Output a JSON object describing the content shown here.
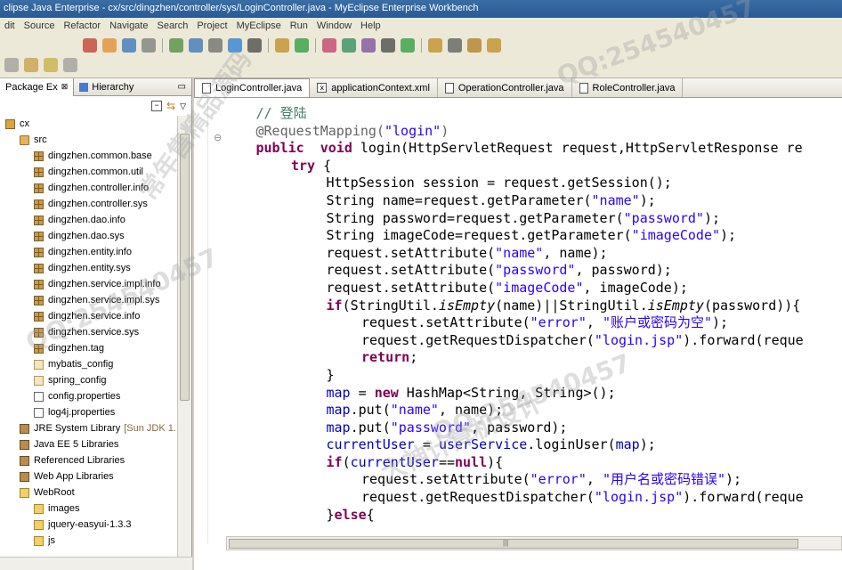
{
  "window": {
    "title": "clipse Java Enterprise - cx/src/dingzhen/controller/sys/LoginController.java - MyEclipse Enterprise Workbench"
  },
  "menu": [
    "dit",
    "Source",
    "Refactor",
    "Navigate",
    "Search",
    "Project",
    "MyEclipse",
    "Run",
    "Window",
    "Help"
  ],
  "left_tabs": {
    "package_explorer": "Package Ex",
    "hierarchy": "Hierarchy"
  },
  "tree": [
    {
      "label": "cx",
      "icon": "project-icon",
      "indent": 0
    },
    {
      "label": "src",
      "icon": "source-folder-icon",
      "indent": 1
    },
    {
      "label": "dingzhen.common.base",
      "icon": "package-icon",
      "indent": 2
    },
    {
      "label": "dingzhen.common.util",
      "icon": "package-icon",
      "indent": 2
    },
    {
      "label": "dingzhen.controller.info",
      "icon": "package-icon",
      "indent": 2
    },
    {
      "label": "dingzhen.controller.sys",
      "icon": "package-icon",
      "indent": 2
    },
    {
      "label": "dingzhen.dao.info",
      "icon": "package-icon",
      "indent": 2
    },
    {
      "label": "dingzhen.dao.sys",
      "icon": "package-icon",
      "indent": 2
    },
    {
      "label": "dingzhen.entity.info",
      "icon": "package-icon",
      "indent": 2
    },
    {
      "label": "dingzhen.entity.sys",
      "icon": "package-icon",
      "indent": 2
    },
    {
      "label": "dingzhen.service.impl.info",
      "icon": "package-icon",
      "indent": 2
    },
    {
      "label": "dingzhen.service.impl.sys",
      "icon": "package-icon",
      "indent": 2
    },
    {
      "label": "dingzhen.service.info",
      "icon": "package-icon",
      "indent": 2
    },
    {
      "label": "dingzhen.service.sys",
      "icon": "package-icon",
      "indent": 2
    },
    {
      "label": "dingzhen.tag",
      "icon": "package-icon",
      "indent": 2
    },
    {
      "label": "mybatis_config",
      "icon": "empty-package-icon",
      "indent": 2
    },
    {
      "label": "spring_config",
      "icon": "empty-package-icon",
      "indent": 2
    },
    {
      "label": "config.properties",
      "icon": "file-icon",
      "indent": 2
    },
    {
      "label": "log4j.properties",
      "icon": "file-icon",
      "indent": 2
    },
    {
      "label": "JRE System Library",
      "suffix": "[Sun JDK 1.",
      "icon": "library-icon",
      "indent": 1
    },
    {
      "label": "Java EE 5 Libraries",
      "icon": "library-icon",
      "indent": 1
    },
    {
      "label": "Referenced Libraries",
      "icon": "library-icon",
      "indent": 1
    },
    {
      "label": "Web App Libraries",
      "icon": "library-icon",
      "indent": 1
    },
    {
      "label": "WebRoot",
      "icon": "folder-icon",
      "indent": 1
    },
    {
      "label": "images",
      "icon": "folder-icon",
      "indent": 2
    },
    {
      "label": "jquery-easyui-1.3.3",
      "icon": "folder-icon",
      "indent": 2
    },
    {
      "label": "js",
      "icon": "folder-icon",
      "indent": 2
    }
  ],
  "editor_tabs": [
    {
      "label": "LoginController.java",
      "active": true,
      "icon": "java-file-icon"
    },
    {
      "label": "applicationContext.xml",
      "active": false,
      "icon": "xml-file-icon"
    },
    {
      "label": "OperationController.java",
      "active": false,
      "icon": "java-file-icon"
    },
    {
      "label": "RoleController.java",
      "active": false,
      "icon": "java-file-icon"
    }
  ],
  "code_lines": [
    [
      [
        "cmt",
        "// 登陆"
      ]
    ],
    [
      [
        "ann",
        "@RequestMapping("
      ],
      [
        "str",
        "\"login\""
      ],
      [
        "ann",
        ")"
      ]
    ],
    [
      [
        "kw",
        "public"
      ],
      [
        "",
        "  "
      ],
      [
        "kw",
        "void"
      ],
      [
        "",
        " login(HttpServletRequest request,HttpServletResponse re"
      ]
    ],
    [
      [
        "kw",
        "try"
      ],
      [
        "",
        " {"
      ]
    ],
    [
      [
        "",
        "HttpSession session = request.getSession();"
      ]
    ],
    [
      [
        "",
        "String name=request.getParameter("
      ],
      [
        "str",
        "\"name\""
      ],
      [
        "",
        ");"
      ]
    ],
    [
      [
        "",
        "String password=request.getParameter("
      ],
      [
        "str",
        "\"password\""
      ],
      [
        "",
        ");"
      ]
    ],
    [
      [
        "",
        "String imageCode=request.getParameter("
      ],
      [
        "str",
        "\"imageCode\""
      ],
      [
        "",
        ");"
      ]
    ],
    [
      [
        "",
        "request.setAttribute("
      ],
      [
        "str",
        "\"name\""
      ],
      [
        "",
        ", name);"
      ]
    ],
    [
      [
        "",
        "request.setAttribute("
      ],
      [
        "str",
        "\"password\""
      ],
      [
        "",
        ", password);"
      ]
    ],
    [
      [
        "",
        "request.setAttribute("
      ],
      [
        "str",
        "\"imageCode\""
      ],
      [
        "",
        ", imageCode);"
      ]
    ],
    [
      [
        "kw",
        "if"
      ],
      [
        "",
        "(StringUtil."
      ],
      [
        "itl",
        "isEmpty"
      ],
      [
        "",
        "(name)||StringUtil."
      ],
      [
        "itl",
        "isEmpty"
      ],
      [
        "",
        "(password)){"
      ]
    ],
    [
      [
        "",
        "request.setAttribute("
      ],
      [
        "str",
        "\"error\""
      ],
      [
        "",
        ", "
      ],
      [
        "str",
        "\"账户或密码为空\""
      ],
      [
        "",
        ");"
      ]
    ],
    [
      [
        "",
        "request.getRequestDispatcher("
      ],
      [
        "str",
        "\"login.jsp\""
      ],
      [
        "",
        ").forward(reque"
      ]
    ],
    [
      [
        "kw",
        "return"
      ],
      [
        "",
        ";"
      ]
    ],
    [
      [
        "",
        "}"
      ]
    ],
    [
      [
        "fld",
        "map"
      ],
      [
        "",
        " = "
      ],
      [
        "kw",
        "new"
      ],
      [
        "",
        " HashMap<String, String>();"
      ]
    ],
    [
      [
        "fld",
        "map"
      ],
      [
        "",
        ".put("
      ],
      [
        "str",
        "\"name\""
      ],
      [
        "",
        ", name);"
      ]
    ],
    [
      [
        "fld",
        "map"
      ],
      [
        "",
        ".put("
      ],
      [
        "str",
        "\"password\""
      ],
      [
        "",
        ", password);"
      ]
    ],
    [
      [
        "fld",
        "currentUser"
      ],
      [
        "",
        " = "
      ],
      [
        "fld",
        "userService"
      ],
      [
        "",
        ".loginUser("
      ],
      [
        "fld",
        "map"
      ],
      [
        "",
        ");"
      ]
    ],
    [
      [
        "kw",
        "if"
      ],
      [
        "",
        "("
      ],
      [
        "fld",
        "currentUser"
      ],
      [
        "",
        "=="
      ],
      [
        "kw",
        "null"
      ],
      [
        "",
        ")"
      ],
      [
        "",
        "{"
      ]
    ],
    [
      [
        "",
        "request.setAttribute("
      ],
      [
        "str",
        "\"error\""
      ],
      [
        "",
        ", "
      ],
      [
        "str",
        "\"用户名或密码错误\""
      ],
      [
        "",
        ");"
      ]
    ],
    [
      [
        "",
        "request.getRequestDispatcher("
      ],
      [
        "str",
        "\"login.jsp\""
      ],
      [
        "",
        ").forward(reque"
      ]
    ],
    [
      [
        "",
        "}"
      ],
      [
        "kw",
        "else"
      ],
      [
        "",
        "{"
      ]
    ]
  ],
  "code_indents": [
    1,
    1,
    1,
    2,
    3,
    3,
    3,
    3,
    3,
    3,
    3,
    3,
    4,
    4,
    4,
    3,
    3,
    3,
    3,
    3,
    3,
    4,
    4,
    3
  ],
  "colors": {
    "keyword": "#7f0055",
    "string": "#2a00ff",
    "comment": "#3f7f5f",
    "annotation": "#646464",
    "field": "#0000c0"
  },
  "watermarks": [
    "QQ:254540457",
    "常年售精品源码",
    "大神计算机设计"
  ]
}
